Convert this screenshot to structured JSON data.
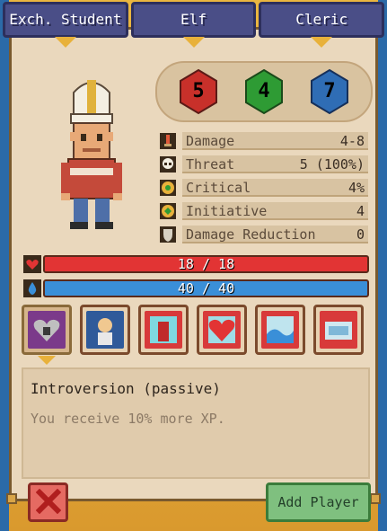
{
  "tabs": [
    {
      "label": "Exch. Student"
    },
    {
      "label": "Elf"
    },
    {
      "label": "Cleric"
    }
  ],
  "dice": [
    {
      "value": "5",
      "color": "#c8302a"
    },
    {
      "value": "4",
      "color": "#2e9b34"
    },
    {
      "value": "7",
      "color": "#2f6db5"
    }
  ],
  "stats": [
    {
      "label": "Damage",
      "value": "4-8",
      "icon": "sword-icon"
    },
    {
      "label": "Threat",
      "value": "5 (100%)",
      "icon": "skull-icon"
    },
    {
      "label": "Critical",
      "value": "4%",
      "icon": "target-icon"
    },
    {
      "label": "Initiative",
      "value": "4",
      "icon": "initiative-icon"
    },
    {
      "label": "Damage Reduction",
      "value": "0",
      "icon": "shield-icon"
    }
  ],
  "hp": {
    "text": "18 / 18",
    "fraction": 1.0,
    "color": "#e23434"
  },
  "mp": {
    "text": "40 / 40",
    "fraction": 1.0,
    "color": "#3a8fd8"
  },
  "skills": [
    {
      "name": "introversion-skill",
      "selected": true
    },
    {
      "name": "elf-skill",
      "selected": false
    },
    {
      "name": "cleric-skill-1",
      "selected": false
    },
    {
      "name": "cleric-skill-2",
      "selected": false
    },
    {
      "name": "cleric-skill-3",
      "selected": false
    },
    {
      "name": "cleric-skill-4",
      "selected": false
    }
  ],
  "description": {
    "title": "Introversion (passive)",
    "body": "You receive 10% more XP."
  },
  "buttons": {
    "add_player": "Add Player"
  }
}
